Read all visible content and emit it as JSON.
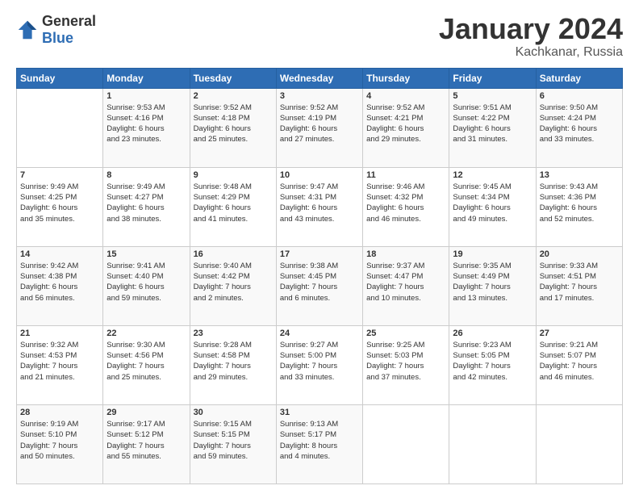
{
  "logo": {
    "general": "General",
    "blue": "Blue"
  },
  "header": {
    "month": "January 2024",
    "location": "Kachkanar, Russia"
  },
  "days": [
    "Sunday",
    "Monday",
    "Tuesday",
    "Wednesday",
    "Thursday",
    "Friday",
    "Saturday"
  ],
  "weeks": [
    [
      {
        "day": "",
        "content": ""
      },
      {
        "day": "1",
        "content": "Sunrise: 9:53 AM\nSunset: 4:16 PM\nDaylight: 6 hours\nand 23 minutes."
      },
      {
        "day": "2",
        "content": "Sunrise: 9:52 AM\nSunset: 4:18 PM\nDaylight: 6 hours\nand 25 minutes."
      },
      {
        "day": "3",
        "content": "Sunrise: 9:52 AM\nSunset: 4:19 PM\nDaylight: 6 hours\nand 27 minutes."
      },
      {
        "day": "4",
        "content": "Sunrise: 9:52 AM\nSunset: 4:21 PM\nDaylight: 6 hours\nand 29 minutes."
      },
      {
        "day": "5",
        "content": "Sunrise: 9:51 AM\nSunset: 4:22 PM\nDaylight: 6 hours\nand 31 minutes."
      },
      {
        "day": "6",
        "content": "Sunrise: 9:50 AM\nSunset: 4:24 PM\nDaylight: 6 hours\nand 33 minutes."
      }
    ],
    [
      {
        "day": "7",
        "content": "Sunrise: 9:49 AM\nSunset: 4:25 PM\nDaylight: 6 hours\nand 35 minutes."
      },
      {
        "day": "8",
        "content": "Sunrise: 9:49 AM\nSunset: 4:27 PM\nDaylight: 6 hours\nand 38 minutes."
      },
      {
        "day": "9",
        "content": "Sunrise: 9:48 AM\nSunset: 4:29 PM\nDaylight: 6 hours\nand 41 minutes."
      },
      {
        "day": "10",
        "content": "Sunrise: 9:47 AM\nSunset: 4:31 PM\nDaylight: 6 hours\nand 43 minutes."
      },
      {
        "day": "11",
        "content": "Sunrise: 9:46 AM\nSunset: 4:32 PM\nDaylight: 6 hours\nand 46 minutes."
      },
      {
        "day": "12",
        "content": "Sunrise: 9:45 AM\nSunset: 4:34 PM\nDaylight: 6 hours\nand 49 minutes."
      },
      {
        "day": "13",
        "content": "Sunrise: 9:43 AM\nSunset: 4:36 PM\nDaylight: 6 hours\nand 52 minutes."
      }
    ],
    [
      {
        "day": "14",
        "content": "Sunrise: 9:42 AM\nSunset: 4:38 PM\nDaylight: 6 hours\nand 56 minutes."
      },
      {
        "day": "15",
        "content": "Sunrise: 9:41 AM\nSunset: 4:40 PM\nDaylight: 6 hours\nand 59 minutes."
      },
      {
        "day": "16",
        "content": "Sunrise: 9:40 AM\nSunset: 4:42 PM\nDaylight: 7 hours\nand 2 minutes."
      },
      {
        "day": "17",
        "content": "Sunrise: 9:38 AM\nSunset: 4:45 PM\nDaylight: 7 hours\nand 6 minutes."
      },
      {
        "day": "18",
        "content": "Sunrise: 9:37 AM\nSunset: 4:47 PM\nDaylight: 7 hours\nand 10 minutes."
      },
      {
        "day": "19",
        "content": "Sunrise: 9:35 AM\nSunset: 4:49 PM\nDaylight: 7 hours\nand 13 minutes."
      },
      {
        "day": "20",
        "content": "Sunrise: 9:33 AM\nSunset: 4:51 PM\nDaylight: 7 hours\nand 17 minutes."
      }
    ],
    [
      {
        "day": "21",
        "content": "Sunrise: 9:32 AM\nSunset: 4:53 PM\nDaylight: 7 hours\nand 21 minutes."
      },
      {
        "day": "22",
        "content": "Sunrise: 9:30 AM\nSunset: 4:56 PM\nDaylight: 7 hours\nand 25 minutes."
      },
      {
        "day": "23",
        "content": "Sunrise: 9:28 AM\nSunset: 4:58 PM\nDaylight: 7 hours\nand 29 minutes."
      },
      {
        "day": "24",
        "content": "Sunrise: 9:27 AM\nSunset: 5:00 PM\nDaylight: 7 hours\nand 33 minutes."
      },
      {
        "day": "25",
        "content": "Sunrise: 9:25 AM\nSunset: 5:03 PM\nDaylight: 7 hours\nand 37 minutes."
      },
      {
        "day": "26",
        "content": "Sunrise: 9:23 AM\nSunset: 5:05 PM\nDaylight: 7 hours\nand 42 minutes."
      },
      {
        "day": "27",
        "content": "Sunrise: 9:21 AM\nSunset: 5:07 PM\nDaylight: 7 hours\nand 46 minutes."
      }
    ],
    [
      {
        "day": "28",
        "content": "Sunrise: 9:19 AM\nSunset: 5:10 PM\nDaylight: 7 hours\nand 50 minutes."
      },
      {
        "day": "29",
        "content": "Sunrise: 9:17 AM\nSunset: 5:12 PM\nDaylight: 7 hours\nand 55 minutes."
      },
      {
        "day": "30",
        "content": "Sunrise: 9:15 AM\nSunset: 5:15 PM\nDaylight: 7 hours\nand 59 minutes."
      },
      {
        "day": "31",
        "content": "Sunrise: 9:13 AM\nSunset: 5:17 PM\nDaylight: 8 hours\nand 4 minutes."
      },
      {
        "day": "",
        "content": ""
      },
      {
        "day": "",
        "content": ""
      },
      {
        "day": "",
        "content": ""
      }
    ]
  ]
}
